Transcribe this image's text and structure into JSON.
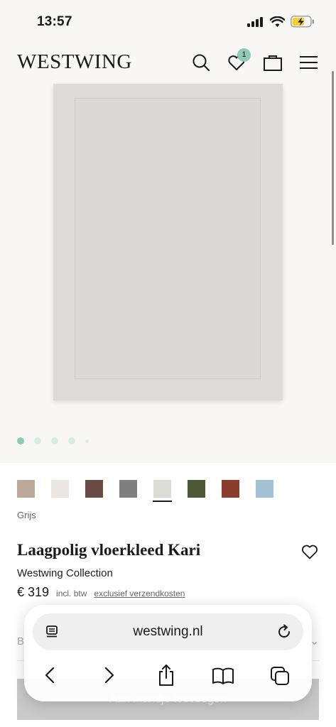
{
  "status": {
    "time": "13:57"
  },
  "header": {
    "logo": "WESTWING",
    "wishlist_count": "1"
  },
  "gallery": {
    "slide_count": 5,
    "active_slide": 1
  },
  "product": {
    "swatches": [
      {
        "color": "#bca99a"
      },
      {
        "color": "#e9e7df"
      },
      {
        "color": "#6a4b43"
      },
      {
        "color": "#7f7f7f"
      },
      {
        "color": "#dddbd6",
        "selected": true
      },
      {
        "color": "#4b5a35"
      },
      {
        "color": "#8d3b2d"
      },
      {
        "color": "#a2c1d5"
      }
    ],
    "selected_color": "Grijs",
    "title": "Laagpolig vloerkleed Kari",
    "brand": "Westwing Collection",
    "price": "€ 319",
    "vat_label": "incl. btw",
    "shipping_link": "exclusief verzendkosten",
    "size_row_label": "B",
    "add_to_cart_label": "Aan mandje toevoegen"
  },
  "browser": {
    "url": "westwing.nl"
  },
  "colors": {
    "accent": "#8fc9b7",
    "background": "#f8f7f5"
  }
}
